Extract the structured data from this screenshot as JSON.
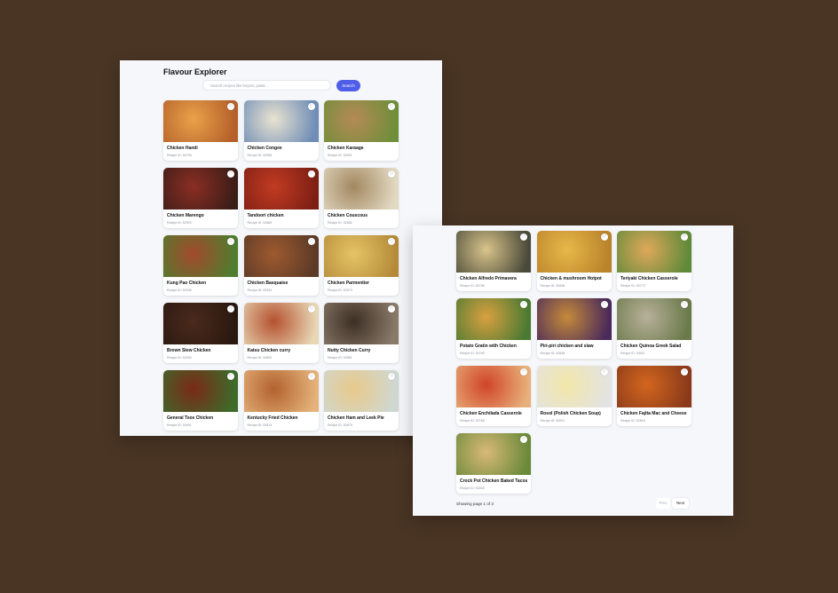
{
  "app": {
    "title": "Flavour Explorer"
  },
  "search": {
    "placeholder": "Search recipes like biryani, pasta...",
    "button_label": "Search"
  },
  "favorite_icon": "heart-icon",
  "page1": {
    "recipes": [
      {
        "name": "Chicken Handi",
        "id": "Recipe ID: 52795",
        "colors": [
          "#e8a24a",
          "#b5602a"
        ]
      },
      {
        "name": "Chicken Congee",
        "id": "Recipe ID: 52956",
        "colors": [
          "#e9e3d0",
          "#6f8db7"
        ]
      },
      {
        "name": "Chicken Karaage",
        "id": "Recipe ID: 52831",
        "colors": [
          "#b58a55",
          "#6f8e3a"
        ]
      },
      {
        "name": "Chicken Marengo",
        "id": "Recipe ID: 52920",
        "colors": [
          "#8b2e24",
          "#3b1d17"
        ]
      },
      {
        "name": "Tandoori chicken",
        "id": "Recipe ID: 52880",
        "colors": [
          "#c23b22",
          "#7e1f14"
        ]
      },
      {
        "name": "Chicken Couscous",
        "id": "Recipe ID: 52850",
        "colors": [
          "#a38861",
          "#e2d9c2"
        ]
      },
      {
        "name": "Kung Pao Chicken",
        "id": "Recipe ID: 52945",
        "colors": [
          "#a34a2c",
          "#4e7d2f"
        ]
      },
      {
        "name": "Chicken Basquaise",
        "id": "Recipe ID: 52934",
        "colors": [
          "#9e5a2f",
          "#5b3a27"
        ]
      },
      {
        "name": "Chicken Parmentier",
        "id": "Recipe ID: 52979",
        "colors": [
          "#e6c466",
          "#b58b3a"
        ]
      },
      {
        "name": "Brown Stew Chicken",
        "id": "Recipe ID: 52940",
        "colors": [
          "#4a2a1c",
          "#2a1810"
        ]
      },
      {
        "name": "Katsu Chicken curry",
        "id": "Recipe ID: 52820",
        "colors": [
          "#b5512f",
          "#e8d7b5"
        ]
      },
      {
        "name": "Nutty Chicken Curry",
        "id": "Recipe ID: 52851",
        "colors": [
          "#3e2f25",
          "#8a7a6a"
        ]
      },
      {
        "name": "General Tsos Chicken",
        "id": "Recipe ID: 52951",
        "colors": [
          "#7a2a18",
          "#3d6b2a"
        ]
      },
      {
        "name": "Kentucky Fried Chicken",
        "id": "Recipe ID: 52813",
        "colors": [
          "#b3622e",
          "#e4b27a"
        ]
      },
      {
        "name": "Chicken Ham and Leek Pie",
        "id": "Recipe ID: 52875",
        "colors": [
          "#e8c98a",
          "#cfd8d2"
        ]
      }
    ]
  },
  "page2": {
    "recipes": [
      {
        "name": "Chicken Alfredo Primavera",
        "id": "Recipe ID: 52796",
        "colors": [
          "#d9c48a",
          "#4a4a3a"
        ]
      },
      {
        "name": "Chicken & mushroom Hotpot",
        "id": "Recipe ID: 52846",
        "colors": [
          "#e8b84a",
          "#b9832a"
        ]
      },
      {
        "name": "Teriyaki Chicken Casserole",
        "id": "Recipe ID: 52772",
        "colors": [
          "#e0a85a",
          "#5f8a3a"
        ]
      },
      {
        "name": "Potato Gratin with Chicken",
        "id": "Recipe ID: 52780",
        "colors": [
          "#d9a040",
          "#4a7a32"
        ]
      },
      {
        "name": "Piri-piri chicken and slaw",
        "id": "Recipe ID: 52838",
        "colors": [
          "#c58a3a",
          "#4a2a5a"
        ]
      },
      {
        "name": "Chicken Quinoa Greek Salad",
        "id": "Recipe ID: 53011",
        "colors": [
          "#b8b09a",
          "#6a7a4a"
        ]
      },
      {
        "name": "Chicken Enchilada Casserole",
        "id": "Recipe ID: 52765",
        "colors": [
          "#d0442a",
          "#e8b07a"
        ]
      },
      {
        "name": "Rosol (Polish Chicken Soup)",
        "id": "Recipe ID: 53001",
        "colors": [
          "#f2e6a8",
          "#e3e3e3"
        ]
      },
      {
        "name": "Chicken Fajita Mac and Cheese",
        "id": "Recipe ID: 52818",
        "colors": [
          "#d2661f",
          "#8a3a1a"
        ]
      },
      {
        "name": "Crock Pot Chicken Baked Tacos",
        "id": "Recipe ID: 52830",
        "colors": [
          "#d9b878",
          "#6a8a3a"
        ]
      }
    ],
    "pagination": {
      "status": "Showing page 1 of 3",
      "prev_label": "Prev",
      "next_label": "Next"
    }
  }
}
